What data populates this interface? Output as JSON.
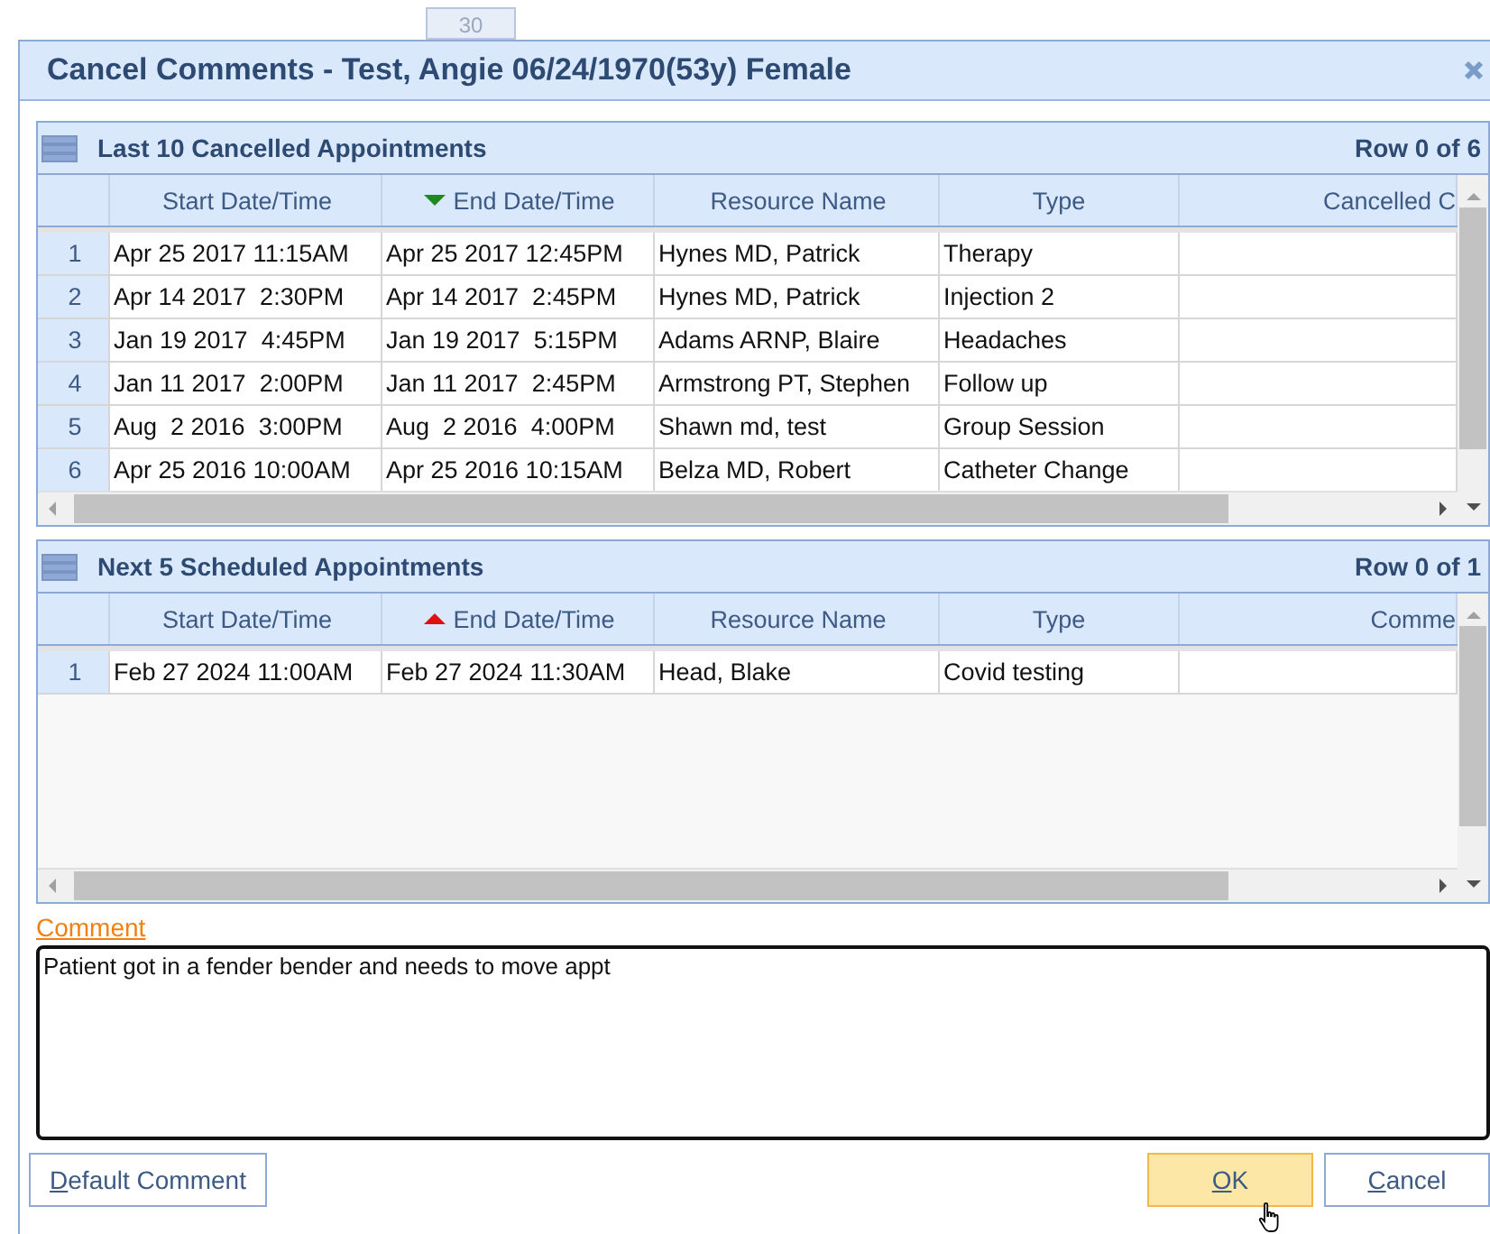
{
  "background": {
    "calendar_day": "30"
  },
  "window": {
    "title": "Cancel Comments - Test, Angie 06/24/1970(53y) Female"
  },
  "panels": [
    {
      "title": "Last 10 Cancelled Appointments",
      "row_status": "Row 0 of 6",
      "columns": [
        {
          "label": "Start Date/Time",
          "sorted_ascending": false,
          "sorted_descending": false
        },
        {
          "label": "End Date/Time",
          "sorted_ascending": false,
          "sorted_descending": true
        },
        {
          "label": "Resource Name",
          "sorted_ascending": false,
          "sorted_descending": false
        },
        {
          "label": "Type",
          "sorted_ascending": false,
          "sorted_descending": false
        },
        {
          "label": "Cancelled C",
          "sorted_ascending": false,
          "sorted_descending": false
        }
      ],
      "rows": [
        {
          "number": "1",
          "cells": [
            "Apr 25 2017 11:15AM",
            "Apr 25 2017 12:45PM",
            "Hynes MD, Patrick",
            "Therapy"
          ]
        },
        {
          "number": "2",
          "cells": [
            "Apr 14 2017  2:30PM",
            "Apr 14 2017  2:45PM",
            "Hynes MD, Patrick",
            "Injection 2"
          ]
        },
        {
          "number": "3",
          "cells": [
            "Jan 19 2017  4:45PM",
            "Jan 19 2017  5:15PM",
            "Adams ARNP, Blaire",
            "Headaches"
          ]
        },
        {
          "number": "4",
          "cells": [
            "Jan 11 2017  2:00PM",
            "Jan 11 2017  2:45PM",
            "Armstrong PT, Stephen",
            "Follow up"
          ]
        },
        {
          "number": "5",
          "cells": [
            "Aug  2 2016  3:00PM",
            "Aug  2 2016  4:00PM",
            "Shawn md, test",
            "Group Session"
          ]
        },
        {
          "number": "6",
          "cells": [
            "Apr 25 2016 10:00AM",
            "Apr 25 2016 10:15AM",
            "Belza MD, Robert",
            "Catheter Change"
          ]
        }
      ]
    },
    {
      "title": "Next 5 Scheduled Appointments",
      "row_status": "Row 0 of 1",
      "columns": [
        {
          "label": "Start Date/Time",
          "sorted_ascending": false,
          "sorted_descending": false
        },
        {
          "label": "End Date/Time",
          "sorted_ascending": true,
          "sorted_descending": false
        },
        {
          "label": "Resource Name",
          "sorted_ascending": false,
          "sorted_descending": false
        },
        {
          "label": "Type",
          "sorted_ascending": false,
          "sorted_descending": false
        },
        {
          "label": "Comme",
          "sorted_ascending": false,
          "sorted_descending": false
        }
      ],
      "rows": [
        {
          "number": "1",
          "cells": [
            "Feb 27 2024 11:00AM",
            "Feb 27 2024 11:30AM",
            "Head, Blake",
            "Covid testing"
          ]
        }
      ]
    }
  ],
  "comment": {
    "label": "Comment",
    "value": "Patient got in a fender bender and needs to move appt"
  },
  "buttons": [
    {
      "label": "Default Comment",
      "mnemonic_first": true,
      "highlighted": false,
      "left_aligned": true
    },
    {
      "label": "OK",
      "mnemonic_first": true,
      "highlighted": true,
      "left_aligned": false
    },
    {
      "label": "Cancel",
      "mnemonic_first": true,
      "highlighted": false,
      "left_aligned": false
    }
  ]
}
